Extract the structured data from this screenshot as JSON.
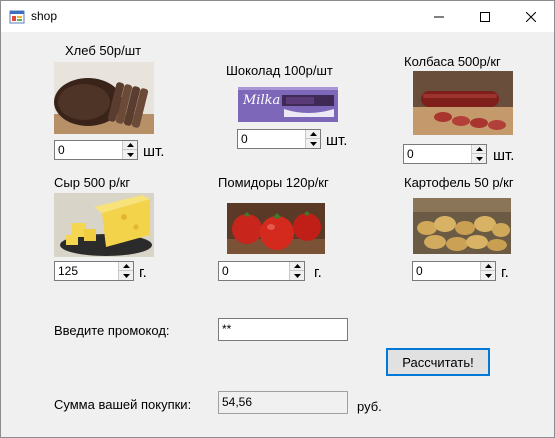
{
  "window": {
    "title": "shop"
  },
  "products": [
    {
      "label": "Хлеб 50р/шт",
      "qty": "0",
      "unit": "шт."
    },
    {
      "label": "Шоколад 100р/шт",
      "qty": "0",
      "unit": "шт."
    },
    {
      "label": "Колбаса 500р/кг",
      "qty": "0",
      "unit": "шт."
    },
    {
      "label": "Сыр 500 р/кг",
      "qty": "125",
      "unit": "г."
    },
    {
      "label": "Помидоры 120р/кг",
      "qty": "0",
      "unit": "г."
    },
    {
      "label": "Картофель 50 р/кг",
      "qty": "0",
      "unit": "г."
    }
  ],
  "promo": {
    "label": "Введите промокод:",
    "value": "**"
  },
  "calculate_label": "Рассчитать!",
  "total": {
    "label": "Сумма вашей покупки:",
    "value": "54,56",
    "currency": "руб."
  },
  "chocolate_brand": "Milka",
  "colors": {
    "accent": "#0078d7",
    "window_bg": "#f0f0f0"
  }
}
